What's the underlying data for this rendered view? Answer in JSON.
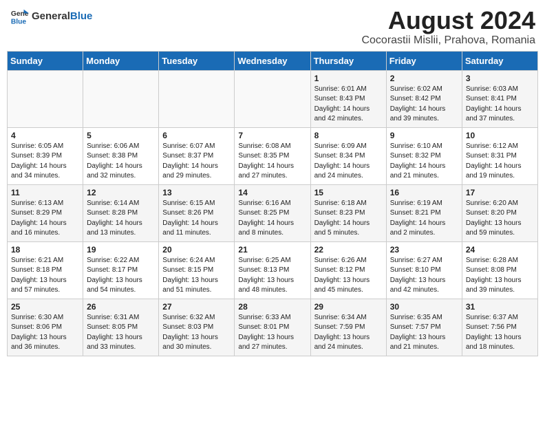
{
  "logo": {
    "general": "General",
    "blue": "Blue"
  },
  "title": "August 2024",
  "subtitle": "Cocorastii Mislii, Prahova, Romania",
  "weekdays": [
    "Sunday",
    "Monday",
    "Tuesday",
    "Wednesday",
    "Thursday",
    "Friday",
    "Saturday"
  ],
  "weeks": [
    [
      {
        "day": "",
        "info": ""
      },
      {
        "day": "",
        "info": ""
      },
      {
        "day": "",
        "info": ""
      },
      {
        "day": "",
        "info": ""
      },
      {
        "day": "1",
        "info": "Sunrise: 6:01 AM\nSunset: 8:43 PM\nDaylight: 14 hours\nand 42 minutes."
      },
      {
        "day": "2",
        "info": "Sunrise: 6:02 AM\nSunset: 8:42 PM\nDaylight: 14 hours\nand 39 minutes."
      },
      {
        "day": "3",
        "info": "Sunrise: 6:03 AM\nSunset: 8:41 PM\nDaylight: 14 hours\nand 37 minutes."
      }
    ],
    [
      {
        "day": "4",
        "info": "Sunrise: 6:05 AM\nSunset: 8:39 PM\nDaylight: 14 hours\nand 34 minutes."
      },
      {
        "day": "5",
        "info": "Sunrise: 6:06 AM\nSunset: 8:38 PM\nDaylight: 14 hours\nand 32 minutes."
      },
      {
        "day": "6",
        "info": "Sunrise: 6:07 AM\nSunset: 8:37 PM\nDaylight: 14 hours\nand 29 minutes."
      },
      {
        "day": "7",
        "info": "Sunrise: 6:08 AM\nSunset: 8:35 PM\nDaylight: 14 hours\nand 27 minutes."
      },
      {
        "day": "8",
        "info": "Sunrise: 6:09 AM\nSunset: 8:34 PM\nDaylight: 14 hours\nand 24 minutes."
      },
      {
        "day": "9",
        "info": "Sunrise: 6:10 AM\nSunset: 8:32 PM\nDaylight: 14 hours\nand 21 minutes."
      },
      {
        "day": "10",
        "info": "Sunrise: 6:12 AM\nSunset: 8:31 PM\nDaylight: 14 hours\nand 19 minutes."
      }
    ],
    [
      {
        "day": "11",
        "info": "Sunrise: 6:13 AM\nSunset: 8:29 PM\nDaylight: 14 hours\nand 16 minutes."
      },
      {
        "day": "12",
        "info": "Sunrise: 6:14 AM\nSunset: 8:28 PM\nDaylight: 14 hours\nand 13 minutes."
      },
      {
        "day": "13",
        "info": "Sunrise: 6:15 AM\nSunset: 8:26 PM\nDaylight: 14 hours\nand 11 minutes."
      },
      {
        "day": "14",
        "info": "Sunrise: 6:16 AM\nSunset: 8:25 PM\nDaylight: 14 hours\nand 8 minutes."
      },
      {
        "day": "15",
        "info": "Sunrise: 6:18 AM\nSunset: 8:23 PM\nDaylight: 14 hours\nand 5 minutes."
      },
      {
        "day": "16",
        "info": "Sunrise: 6:19 AM\nSunset: 8:21 PM\nDaylight: 14 hours\nand 2 minutes."
      },
      {
        "day": "17",
        "info": "Sunrise: 6:20 AM\nSunset: 8:20 PM\nDaylight: 13 hours\nand 59 minutes."
      }
    ],
    [
      {
        "day": "18",
        "info": "Sunrise: 6:21 AM\nSunset: 8:18 PM\nDaylight: 13 hours\nand 57 minutes."
      },
      {
        "day": "19",
        "info": "Sunrise: 6:22 AM\nSunset: 8:17 PM\nDaylight: 13 hours\nand 54 minutes."
      },
      {
        "day": "20",
        "info": "Sunrise: 6:24 AM\nSunset: 8:15 PM\nDaylight: 13 hours\nand 51 minutes."
      },
      {
        "day": "21",
        "info": "Sunrise: 6:25 AM\nSunset: 8:13 PM\nDaylight: 13 hours\nand 48 minutes."
      },
      {
        "day": "22",
        "info": "Sunrise: 6:26 AM\nSunset: 8:12 PM\nDaylight: 13 hours\nand 45 minutes."
      },
      {
        "day": "23",
        "info": "Sunrise: 6:27 AM\nSunset: 8:10 PM\nDaylight: 13 hours\nand 42 minutes."
      },
      {
        "day": "24",
        "info": "Sunrise: 6:28 AM\nSunset: 8:08 PM\nDaylight: 13 hours\nand 39 minutes."
      }
    ],
    [
      {
        "day": "25",
        "info": "Sunrise: 6:30 AM\nSunset: 8:06 PM\nDaylight: 13 hours\nand 36 minutes."
      },
      {
        "day": "26",
        "info": "Sunrise: 6:31 AM\nSunset: 8:05 PM\nDaylight: 13 hours\nand 33 minutes."
      },
      {
        "day": "27",
        "info": "Sunrise: 6:32 AM\nSunset: 8:03 PM\nDaylight: 13 hours\nand 30 minutes."
      },
      {
        "day": "28",
        "info": "Sunrise: 6:33 AM\nSunset: 8:01 PM\nDaylight: 13 hours\nand 27 minutes."
      },
      {
        "day": "29",
        "info": "Sunrise: 6:34 AM\nSunset: 7:59 PM\nDaylight: 13 hours\nand 24 minutes."
      },
      {
        "day": "30",
        "info": "Sunrise: 6:35 AM\nSunset: 7:57 PM\nDaylight: 13 hours\nand 21 minutes."
      },
      {
        "day": "31",
        "info": "Sunrise: 6:37 AM\nSunset: 7:56 PM\nDaylight: 13 hours\nand 18 minutes."
      }
    ]
  ]
}
